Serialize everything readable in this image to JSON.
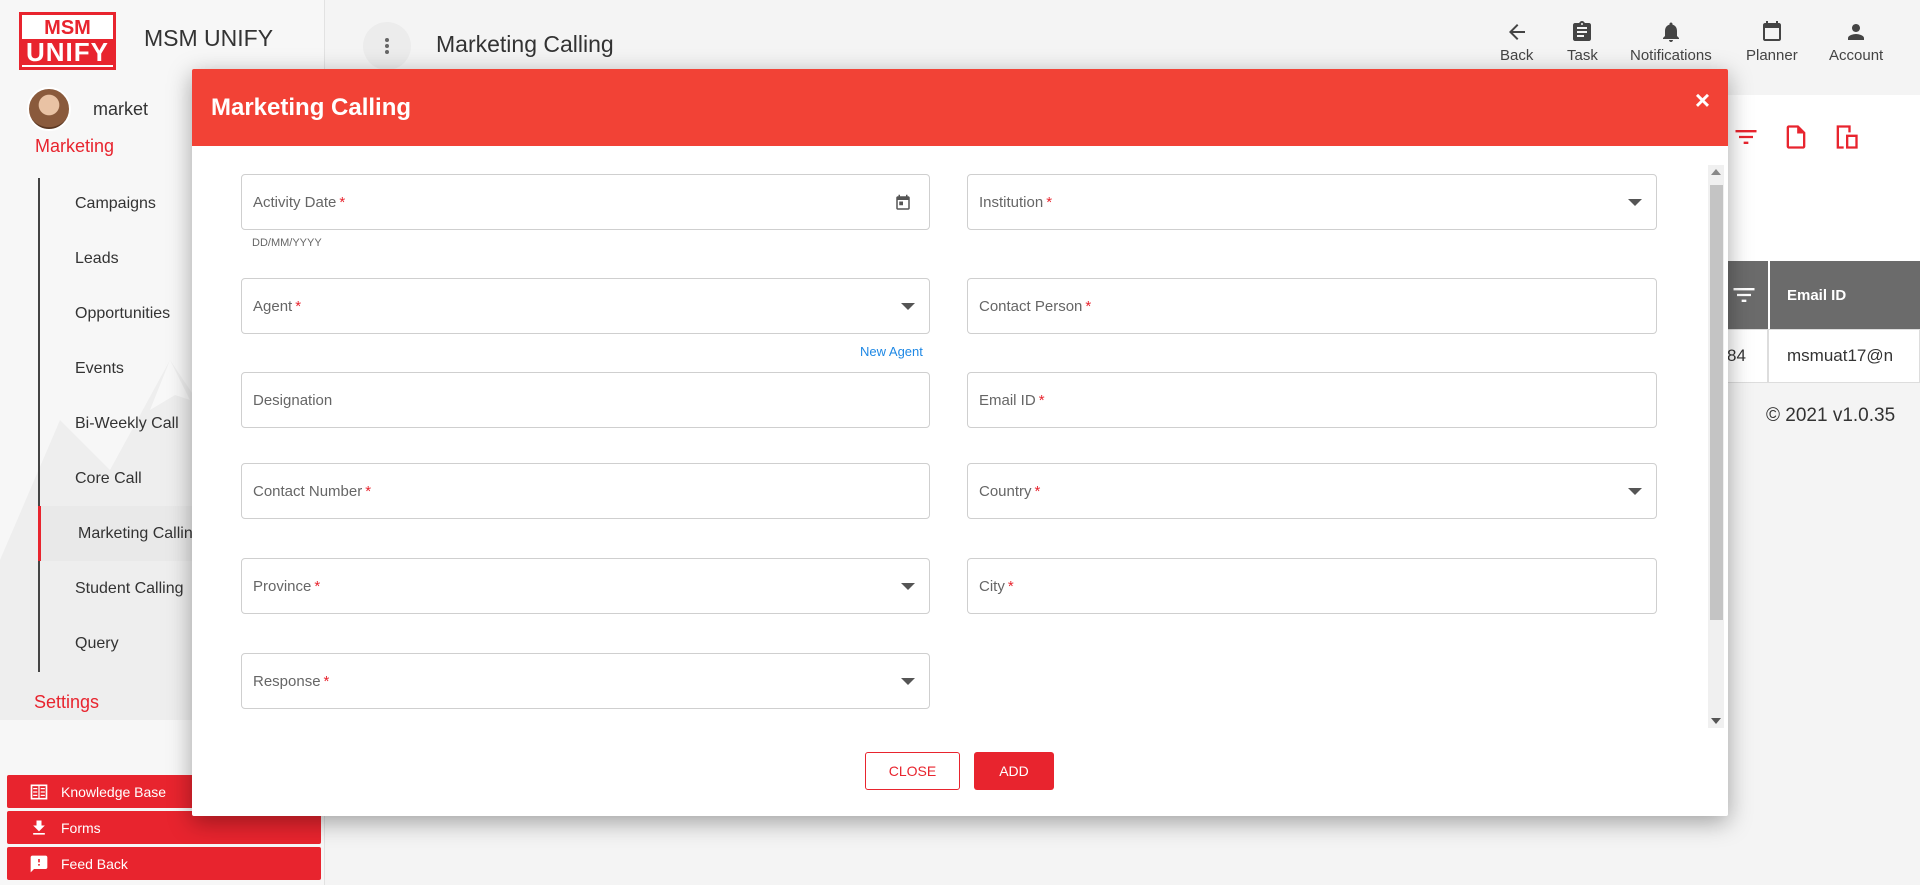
{
  "app": {
    "logo_top": "MSM",
    "logo_bottom": "UNIFY",
    "name": "MSM UNIFY"
  },
  "user": {
    "name": "market"
  },
  "sidebar": {
    "section_label": "Marketing",
    "items": [
      {
        "label": "Campaigns"
      },
      {
        "label": "Leads"
      },
      {
        "label": "Opportunities"
      },
      {
        "label": "Events"
      },
      {
        "label": "Bi-Weekly Call"
      },
      {
        "label": "Core Call"
      },
      {
        "label": "Marketing Calling"
      },
      {
        "label": "Student Calling"
      },
      {
        "label": "Query"
      }
    ],
    "settings_label": "Settings",
    "bottom_buttons": [
      {
        "label": "Knowledge Base",
        "icon": "book-icon"
      },
      {
        "label": "Forms",
        "icon": "download-icon"
      },
      {
        "label": "Feed Back",
        "icon": "feedback-icon"
      }
    ]
  },
  "topbar": {
    "title": "Marketing Calling",
    "actions": [
      {
        "label": "Back",
        "icon": "arrow-left-icon"
      },
      {
        "label": "Task",
        "icon": "clipboard-icon"
      },
      {
        "label": "Notifications",
        "icon": "bell-icon"
      },
      {
        "label": "Planner",
        "icon": "calendar-icon"
      },
      {
        "label": "Account",
        "icon": "person-icon"
      }
    ]
  },
  "background_table": {
    "header_partial": "",
    "header_email": "Email ID",
    "cell_partial": "84",
    "cell_email": "msmuat17@n"
  },
  "footer": {
    "copyright": "© 2021 v1.0.35"
  },
  "modal": {
    "title": "Marketing Calling",
    "close_symbol": "×",
    "fields": {
      "activity_date": {
        "label": "Activity Date",
        "required": "*",
        "hint": "DD/MM/YYYY"
      },
      "institution": {
        "label": "Institution",
        "required": "*"
      },
      "agent": {
        "label": "Agent",
        "required": "*",
        "link": "New Agent"
      },
      "contact_person": {
        "label": "Contact Person",
        "required": "*"
      },
      "designation": {
        "label": "Designation"
      },
      "email_id": {
        "label": "Email ID",
        "required": "*"
      },
      "contact_number": {
        "label": "Contact Number",
        "required": "*"
      },
      "country": {
        "label": "Country",
        "required": "*"
      },
      "province": {
        "label": "Province",
        "required": "*"
      },
      "city": {
        "label": "City",
        "required": "*"
      },
      "response": {
        "label": "Response",
        "required": "*"
      }
    },
    "buttons": {
      "close": "CLOSE",
      "add": "ADD"
    }
  },
  "colors": {
    "accent": "#e8242e",
    "modal_header": "#f24236",
    "link": "#1e88e5"
  }
}
